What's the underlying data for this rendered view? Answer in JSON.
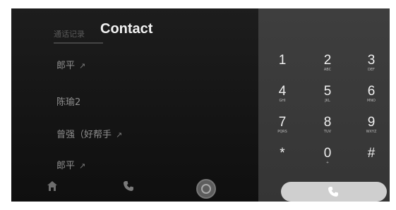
{
  "contacts_panel": {
    "tab_recent": "通话记录",
    "title": "Contact",
    "contacts": [
      {
        "name": "郎平",
        "arrow": "↗"
      },
      {
        "name": "陈瑜2",
        "arrow": ""
      },
      {
        "name": "曾强（好帮手",
        "arrow": "↗"
      },
      {
        "name": "郎平",
        "arrow": "↗"
      }
    ]
  },
  "bottom_nav": {
    "icons": [
      "home-icon",
      "phone-icon",
      "dialpad-circle-icon"
    ]
  },
  "dialpad": {
    "keys": [
      {
        "digit": "1",
        "sub": ""
      },
      {
        "digit": "2",
        "sub": "ABC"
      },
      {
        "digit": "3",
        "sub": "DEF"
      },
      {
        "digit": "4",
        "sub": "GHI"
      },
      {
        "digit": "5",
        "sub": "JKL"
      },
      {
        "digit": "6",
        "sub": "MNO"
      },
      {
        "digit": "7",
        "sub": "PQRS"
      },
      {
        "digit": "8",
        "sub": "TUV"
      },
      {
        "digit": "9",
        "sub": "WXYZ"
      },
      {
        "digit": "*",
        "sub": ""
      },
      {
        "digit": "0",
        "sub": "+"
      },
      {
        "digit": "#",
        "sub": ""
      }
    ],
    "call_icon": "phone-icon"
  },
  "colors": {
    "left_bg": "#161616",
    "right_bg": "#3a3a3a",
    "call_button": "#cfcfcf"
  }
}
